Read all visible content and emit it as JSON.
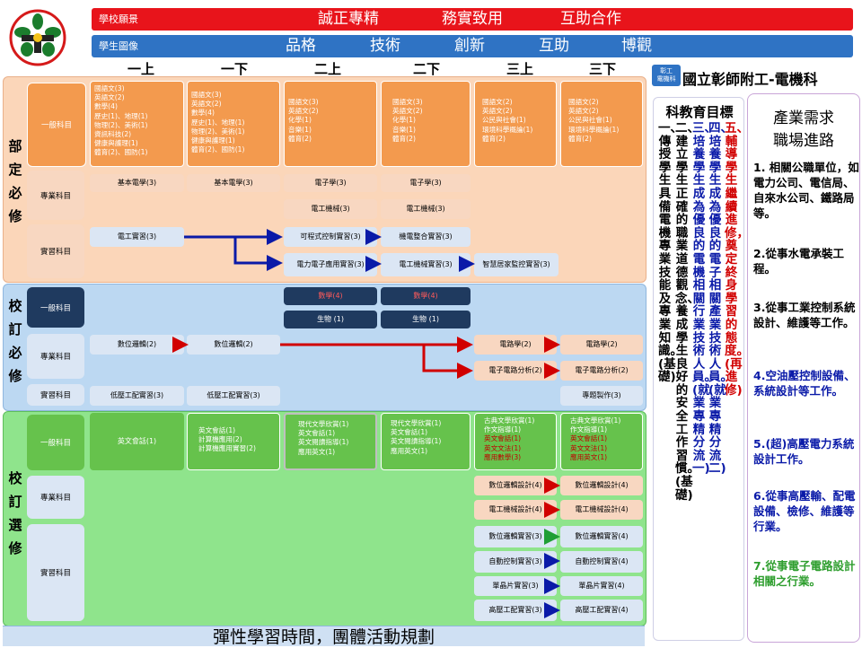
{
  "banners": {
    "vision_label": "學校願景",
    "vision_items": [
      "誠正專精",
      "務實致用",
      "互助合作"
    ],
    "portrait_label": "學生圖像",
    "portrait_items": [
      "品格",
      "技術",
      "創新",
      "互助",
      "博觀"
    ]
  },
  "semesters": [
    "一上",
    "一下",
    "二上",
    "二下",
    "三上",
    "三下"
  ],
  "school": {
    "badge": "彰工\n電機科",
    "name": "國立彰師附工-電機科"
  },
  "sections": {
    "required_dept": {
      "label": "部\n定\n必\n修"
    },
    "required_school": {
      "label": "校\n訂\n必\n修"
    },
    "elective_school": {
      "label": "校\n訂\n選\n修"
    }
  },
  "categories": {
    "general": "一般科目",
    "major": "專業科目",
    "practice": "實習科目"
  },
  "courses": {
    "gen_1a": "國語文(3)\n英語文(2)\n數學(4)\n歷史(1)、地理(1)\n物理(2)、美術(1)\n資訊科技(2)\n健康與護理(1)\n體育(2)、國防(1)",
    "gen_1b": "國語文(3)\n英語文(2)\n數學(4)\n歷史(1)、地理(1)\n物理(2)、美術(1)\n健康與護理(1)\n體育(2)、國防(1)",
    "gen_2a": "國語文(3)\n英語文(2)\n化學(1)\n音樂(1)\n體育(2)",
    "gen_2b": "國語文(3)\n英語文(2)\n化學(1)\n音樂(1)\n體育(2)",
    "gen_3a": "國語文(2)\n英語文(2)\n公民與社會(1)\n環境科學概論(1)\n體育(2)",
    "gen_3b": "國語文(2)\n英語文(2)\n公民與社會(1)\n環境科學概論(1)\n體育(2)",
    "basic_elec_1a": "基本電學(3)",
    "basic_elec_1b": "基本電學(3)",
    "electronics_2a": "電子學(3)",
    "electronics_2b": "電子學(3)",
    "machine_2a": "電工機械(3)",
    "machine_2b": "電工機械(3)",
    "elec_practice_1": "電工實習(3)",
    "plc_2a": "可程式控制實習(3)",
    "electromech_2b": "機電整合實習(3)",
    "power_elec_2a": "電力電子應用實習(3)",
    "machine_prac_2b": "電工機械實習(3)",
    "smart_home_3a": "智慧居家監控實習(3)",
    "math_2a": "數學(4)",
    "math_2b": "數學(4)",
    "bio_2a": "生物 (1)",
    "bio_2b": "生物 (1)",
    "logic_1a": "數位邏輯(2)",
    "logic_1b": "數位邏輯(2)",
    "circuits_3a": "電路學(2)",
    "circuits_3b": "電路學(2)",
    "ecircuit_3a": "電子電路分析(2)",
    "ecircuit_3b": "電子電路分析(2)",
    "lowv_1a": "低壓工配實習(3)",
    "lowv_1b": "低壓工配實習(3)",
    "project_3b": "專題製作(3)",
    "el_gen_1a": "英文會話(1)",
    "el_gen_1b": "英文會話(1)\n計算機應用(2)\n計算機應用實習(2)",
    "el_gen_2a": "現代文學欣賞(1)\n英文會話(1)\n英文閱讀指導(1)\n應用英文(1)",
    "el_gen_2b": "現代文學欣賞(1)\n英文會話(1)\n英文閱讀指導(1)\n應用英文(1)",
    "el_gen_3a_plain": "古典文學欣賞(1)\n作文指導(1)",
    "el_gen_3a_red": "英文會話(1)\n英文文法(1)\n應用數學(3)",
    "el_gen_3b_plain": "古典文學欣賞(1)\n作文指導(1)",
    "el_gen_3b_red": "英文會話(1)\n英文文法(1)\n應用英文(1)",
    "el_logic_design_3a": "數位邏輯設計(4)",
    "el_logic_design_3b": "數位邏輯設計(4)",
    "el_machine_design_3a": "電工機械設計(4)",
    "el_machine_design_3b": "電工機械設計(4)",
    "el_logic_prac_3a": "數位邏輯實習(3)",
    "el_logic_prac_3b": "數位邏輯實習(4)",
    "el_auto_3a": "自動控制實習(3)",
    "el_auto_3b": "自動控制實習(4)",
    "el_mcu_3a": "單晶片實習(3)",
    "el_mcu_3b": "單晶片實習(4)",
    "el_hv_3a": "高壓工配實習(3)",
    "el_hv_3b": "高壓工配實習(4)"
  },
  "objectives": {
    "title": "科教育目標",
    "items": [
      {
        "text": "一、傳授學生具備電機專業技能及專業知識。(基礎)",
        "color": "#000000"
      },
      {
        "text": "二、建立學生正確的職業道德觀念、養成學生良好的安全工作習慣。(基礎)",
        "color": "#000000"
      },
      {
        "text": "三、培養學生成為優良的電機相關行業技術人員。(就業專精分流一)",
        "color": "#0a1aa8"
      },
      {
        "text": "四、培養學生成為優良的電子相關產業技術人員。(就業專精分流二)",
        "color": "#0a1aa8"
      },
      {
        "text": "五、輔導學生繼續進修，奠定終身學習的態度。(再進修)",
        "color": "#d10000"
      }
    ]
  },
  "career": {
    "title": "產業需求\n職場進路",
    "items": [
      {
        "text": "1. 相關公職單位，如電力公司、電信局、自來水公司、鐵路局等。",
        "color": "#000000"
      },
      {
        "text": "2.從事水電承裝工程。",
        "color": "#000000"
      },
      {
        "text": "3.從事工業控制系統設計、維護等工作。",
        "color": "#000000"
      },
      {
        "text": "4.空油壓控制設備、系統設計等工作。",
        "color": "#0a1aa8"
      },
      {
        "text": "5.(超)高壓電力系統設計工作。",
        "color": "#0a1aa8"
      },
      {
        "text": "6.從事高壓輸、配電設備、檢修、維護等行業。",
        "color": "#0a1aa8"
      },
      {
        "text": "7.從事電子電路設計相關之行業。",
        "color": "#2e9e2e"
      }
    ]
  },
  "footer": "彈性學習時間，團體活動規劃",
  "colors": {
    "red_banner": "#e8141b",
    "blue_banner": "#2f73c4",
    "orange": "#f39a4e",
    "peach_band": "#fbd6b9",
    "blue_band": "#bcd8f2",
    "green_band": "#8fe48c",
    "navy": "#1f3a5f",
    "green_box": "#66c24c",
    "arrow_blue": "#0a1aa8",
    "arrow_red": "#d10000",
    "arrow_green": "#1f9e35"
  }
}
